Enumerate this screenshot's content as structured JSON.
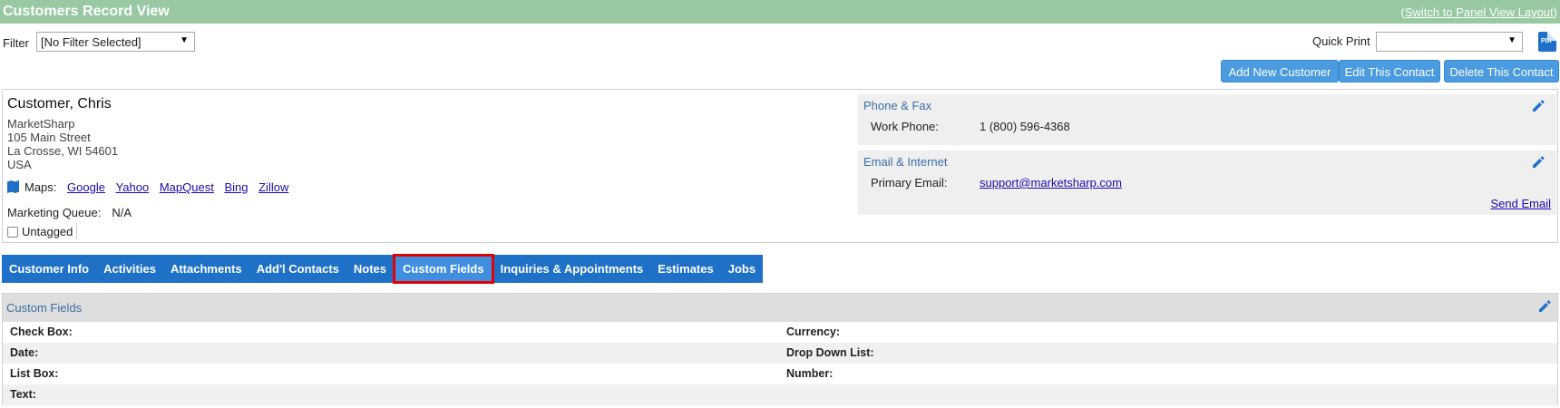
{
  "header": {
    "title": "Customers Record View",
    "switch_prefix": "(",
    "switch_link": "Switch to Panel View Layout",
    "switch_suffix": ")"
  },
  "filter": {
    "label": "Filter",
    "value": "[No Filter Selected]"
  },
  "quick_print": {
    "label": "Quick Print",
    "value": "",
    "pdf_label": "PDF"
  },
  "actions": {
    "add": "Add New Customer",
    "edit": "Edit This Contact",
    "delete": "Delete This Contact"
  },
  "customer": {
    "name": "Customer, Chris",
    "company": "MarketSharp",
    "street": "105 Main Street",
    "city_line": "La Crosse, WI 54601",
    "country": "USA",
    "maps_label": "Maps:",
    "maps_links": [
      "Google",
      "Yahoo",
      "MapQuest",
      "Bing",
      "Zillow"
    ],
    "marketing_queue_label": "Marketing Queue:",
    "marketing_queue_value": "N/A",
    "tag_label": "Untagged"
  },
  "phone_fax": {
    "title": "Phone & Fax",
    "work_phone_label": "Work Phone:",
    "work_phone_value": "1 (800) 596-4368"
  },
  "email_internet": {
    "title": "Email & Internet",
    "primary_email_label": "Primary Email:",
    "primary_email_value": "support@marketsharp.com",
    "send_email": "Send Email"
  },
  "tabs": [
    {
      "label": "Customer Info",
      "active": false
    },
    {
      "label": "Activities",
      "active": false
    },
    {
      "label": "Attachments",
      "active": false
    },
    {
      "label": "Add'l Contacts",
      "active": false
    },
    {
      "label": "Notes",
      "active": false
    },
    {
      "label": "Custom Fields",
      "active": true
    },
    {
      "label": "Inquiries & Appointments",
      "active": false
    },
    {
      "label": "Estimates",
      "active": false
    },
    {
      "label": "Jobs",
      "active": false
    }
  ],
  "custom_fields": {
    "title": "Custom Fields",
    "rows": [
      {
        "left": "Check Box:",
        "right": "Currency:"
      },
      {
        "left": "Date:",
        "right": "Drop Down List:"
      },
      {
        "left": "List Box:",
        "right": "Number:"
      },
      {
        "left": "Text:",
        "right": ""
      }
    ]
  },
  "colors": {
    "header_bg": "#98c9a3",
    "tab_bg": "#1f71c8",
    "button_bg": "#4a9be0",
    "highlight": "#e30000"
  }
}
